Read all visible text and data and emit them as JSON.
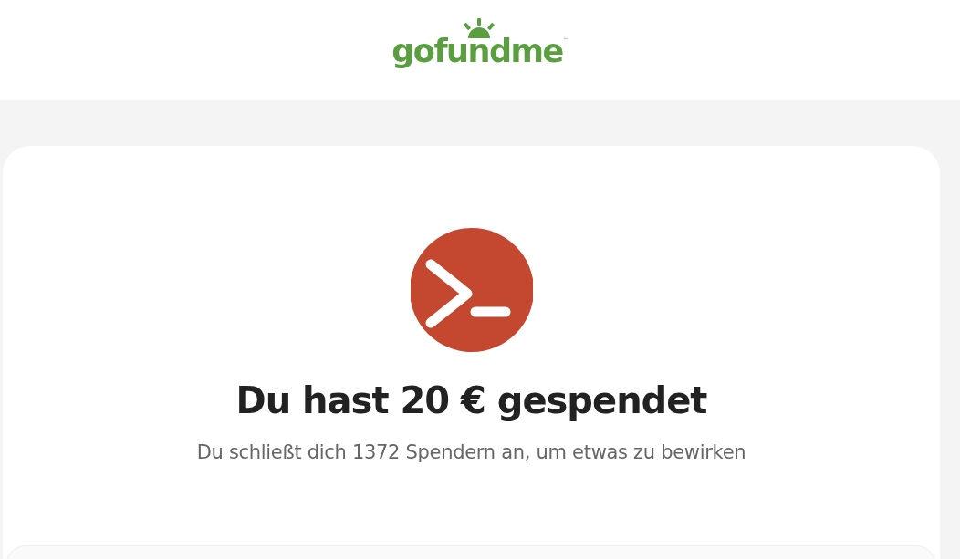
{
  "header": {
    "logo": {
      "name": "gofundme",
      "mark": "™"
    }
  },
  "confirmation": {
    "title": "Du hast 20 € gespendet",
    "message": "Du schließt dich 1372 Spendern an, um etwas zu bewirken"
  }
}
